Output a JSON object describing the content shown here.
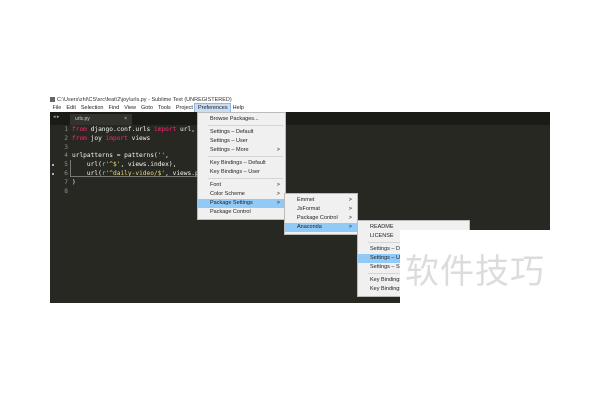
{
  "window": {
    "title": "C:\\Users\\zhl\\CS\\src\\feat\\2\\joy\\urls.py - Sublime Text (UNREGISTERED)"
  },
  "menubar": [
    "File",
    "Edit",
    "Selection",
    "Find",
    "View",
    "Goto",
    "Tools",
    "Project",
    "Preferences",
    "Help"
  ],
  "tab": {
    "label": "urls.py",
    "close": "×",
    "nav": "◂ ▸"
  },
  "gutter": [
    "1",
    "2",
    "3",
    "4",
    "5",
    "6",
    "7",
    "8"
  ],
  "code": [
    [
      [
        "kw",
        "from"
      ],
      [
        "",
        "django.conf.urls "
      ],
      [
        "kw",
        "import"
      ],
      [
        "",
        "url,"
      ]
    ],
    [
      [
        "kw",
        "from"
      ],
      [
        "",
        "joy "
      ],
      [
        "kw",
        "import"
      ],
      [
        "",
        "views"
      ]
    ],
    [],
    [
      [
        "",
        "urlpatterns = patterns("
      ],
      [
        "str",
        "''"
      ],
      [
        "",
        ","
      ]
    ],
    [
      [
        "",
        "    url("
      ],
      [
        "fn",
        "r"
      ],
      [
        "str",
        "'^$'"
      ],
      [
        "",
        ", views.index),"
      ]
    ],
    [
      [
        "",
        "    url("
      ],
      [
        "fn",
        "r"
      ],
      [
        "str",
        "'^daily-video/$'"
      ],
      [
        "",
        ", views.p"
      ]
    ],
    [
      [
        "",
        ")"
      ]
    ],
    []
  ],
  "preferences_menu": [
    {
      "label": "Browse Packages..."
    },
    {
      "sep": true
    },
    {
      "label": "Settings – Default"
    },
    {
      "label": "Settings – User"
    },
    {
      "label": "Settings – More",
      "arrow": ">"
    },
    {
      "sep": true
    },
    {
      "label": "Key Bindings – Default"
    },
    {
      "label": "Key Bindings – User"
    },
    {
      "sep": true
    },
    {
      "label": "Font",
      "arrow": ">"
    },
    {
      "label": "Color Scheme",
      "arrow": ">"
    },
    {
      "label": "Package Settings",
      "arrow": ">",
      "hl": true
    },
    {
      "label": "Package Control"
    }
  ],
  "package_settings_menu": [
    {
      "label": "Emmet",
      "arrow": ">"
    },
    {
      "label": "JsFormat",
      "arrow": ">"
    },
    {
      "label": "Package Control",
      "arrow": ">"
    },
    {
      "label": "Anaconda",
      "arrow": ">",
      "hl": true
    }
  ],
  "anaconda_menu": [
    {
      "label": "README"
    },
    {
      "label": "LICENSE"
    },
    {
      "sep": true
    },
    {
      "label": "Settings – Default"
    },
    {
      "label": "Settings – User",
      "hl": true
    },
    {
      "label": "Settings – SublimeLinter"
    },
    {
      "sep": true
    },
    {
      "label": "Key Bindings – Default"
    },
    {
      "label": "Key Bindings – User"
    }
  ],
  "watermark": "软件技巧"
}
